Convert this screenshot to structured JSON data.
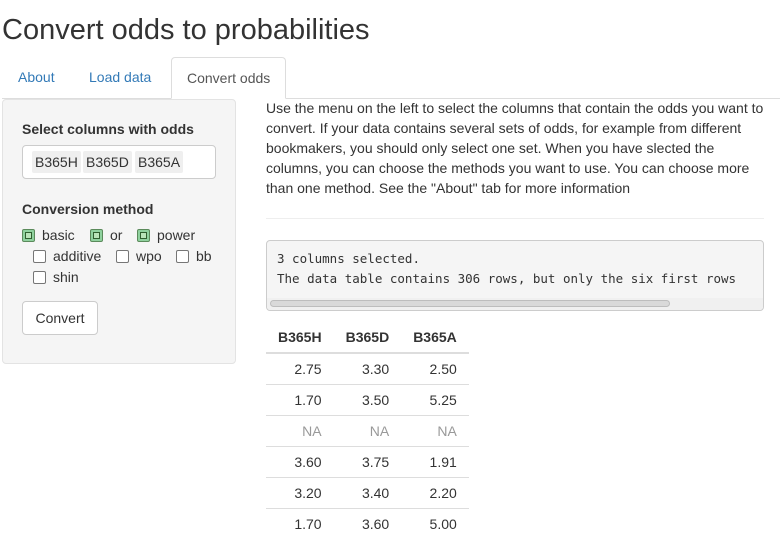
{
  "page_title": "Convert odds to probabilities",
  "tabs": [
    {
      "label": "About"
    },
    {
      "label": "Load data"
    },
    {
      "label": "Convert odds"
    }
  ],
  "sidebar": {
    "columns_label": "Select columns with odds",
    "selected_columns": [
      "B365H",
      "B365D",
      "B365A"
    ],
    "method_label": "Conversion method",
    "methods": [
      {
        "label": "basic",
        "checked": true
      },
      {
        "label": "or",
        "checked": true
      },
      {
        "label": "power",
        "checked": true
      },
      {
        "label": "additive",
        "checked": false
      },
      {
        "label": "wpo",
        "checked": false
      },
      {
        "label": "bb",
        "checked": false
      },
      {
        "label": "shin",
        "checked": false
      }
    ],
    "convert_label": "Convert"
  },
  "main": {
    "intro_text": "Use the menu on the left to select the columns that contain the odds you want to convert. If your data contains several sets of odds, for example from different bookmakers, you should only select one set. When you have slected the columns, you can choose the methods you want to use. You can choose more than one method. See the \"About\" tab for more information",
    "console_lines": [
      "3 columns selected.",
      "The data table contains 306 rows, but only the six first rows"
    ],
    "table": {
      "headers": [
        "B365H",
        "B365D",
        "B365A"
      ],
      "rows": [
        [
          "2.75",
          "3.30",
          "2.50"
        ],
        [
          "1.70",
          "3.50",
          "5.25"
        ],
        [
          "NA",
          "NA",
          "NA"
        ],
        [
          "3.60",
          "3.75",
          "1.91"
        ],
        [
          "3.20",
          "3.40",
          "2.20"
        ],
        [
          "1.70",
          "3.60",
          "5.00"
        ]
      ]
    }
  }
}
